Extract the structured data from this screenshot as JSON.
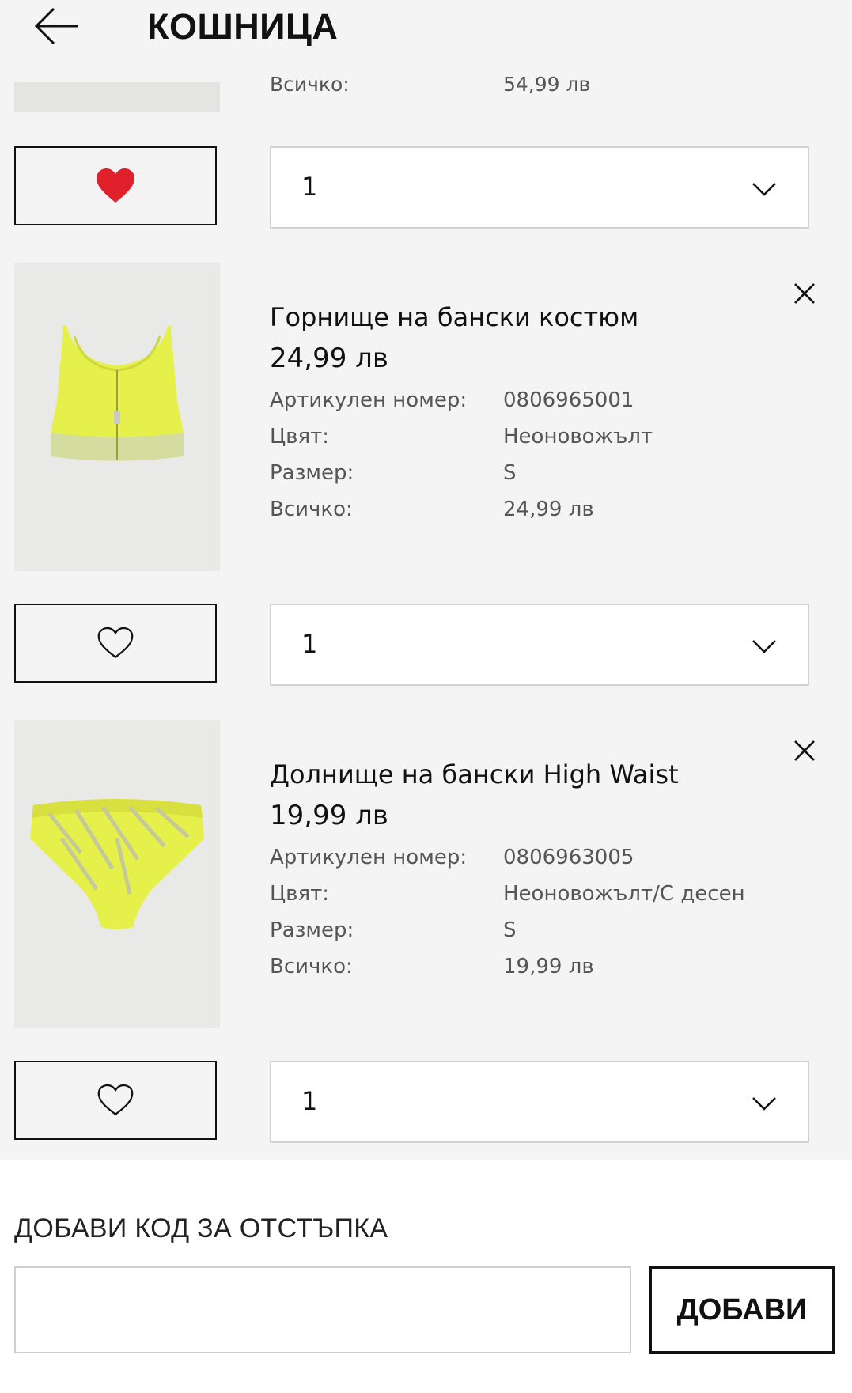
{
  "header": {
    "title": "КОШНИЦА",
    "back_icon": "arrow-left-icon"
  },
  "previous_item": {
    "total_label": "Всичко:",
    "total_value": "54,99 лв",
    "quantity": "1",
    "favorite": true
  },
  "items": [
    {
      "name": "Горнище на бански костюм",
      "price": "24,99 лв",
      "meta": [
        {
          "label": "Артикулен номер:",
          "value": "0806965001"
        },
        {
          "label": "Цвят:",
          "value": "Неоновожълт"
        },
        {
          "label": "Размер:",
          "value": "S"
        },
        {
          "label": "Всичко:",
          "value": "24,99 лв"
        }
      ],
      "quantity": "1",
      "favorite": false
    },
    {
      "name": "Долнище на бански High Waist",
      "price": "19,99 лв",
      "meta": [
        {
          "label": "Артикулен номер:",
          "value": "0806963005"
        },
        {
          "label": "Цвят:",
          "value": "Неоновожълт/С десен"
        },
        {
          "label": "Размер:",
          "value": "S"
        },
        {
          "label": "Всичко:",
          "value": "19,99 лв"
        }
      ],
      "quantity": "1",
      "favorite": false
    }
  ],
  "promo": {
    "title": "ДОБАВИ КОД ЗА ОТСТЪПКА",
    "input_value": "",
    "button_label": "ДОБАВИ"
  },
  "colors": {
    "background": "#f4f4f4",
    "favorite_active": "#e0212b",
    "product_color": "#e8f24a"
  }
}
